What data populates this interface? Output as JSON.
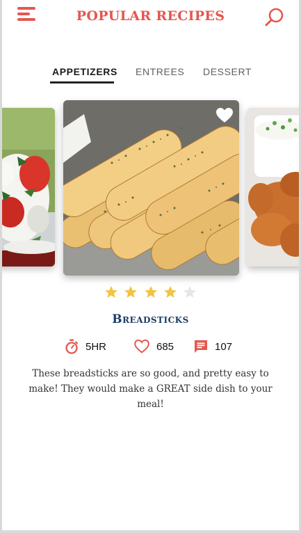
{
  "header": {
    "title": "POPULAR RECIPES",
    "menu_icon": "hamburger-menu-icon",
    "search_icon": "search-icon"
  },
  "tabs": [
    {
      "label": "APPETIZERS",
      "active": true
    },
    {
      "label": "ENTREES",
      "active": false
    },
    {
      "label": "DESSERT",
      "active": false
    }
  ],
  "carousel": {
    "items": [
      "caprese salad",
      "breadsticks",
      "chicken wings with dip"
    ],
    "selected_index": 1
  },
  "recipe": {
    "name": "Breadsticks",
    "rating": 4,
    "rating_max": 5,
    "time": "5HR",
    "likes": "685",
    "comments": "107",
    "description": "These breadsticks are so good, and pretty easy to make! They would make a GREAT side dish to your meal!"
  },
  "colors": {
    "accent": "#e4574f",
    "title_navy": "#1b3d63",
    "star_filled": "#f2c443",
    "star_empty": "#e6e6e6"
  }
}
